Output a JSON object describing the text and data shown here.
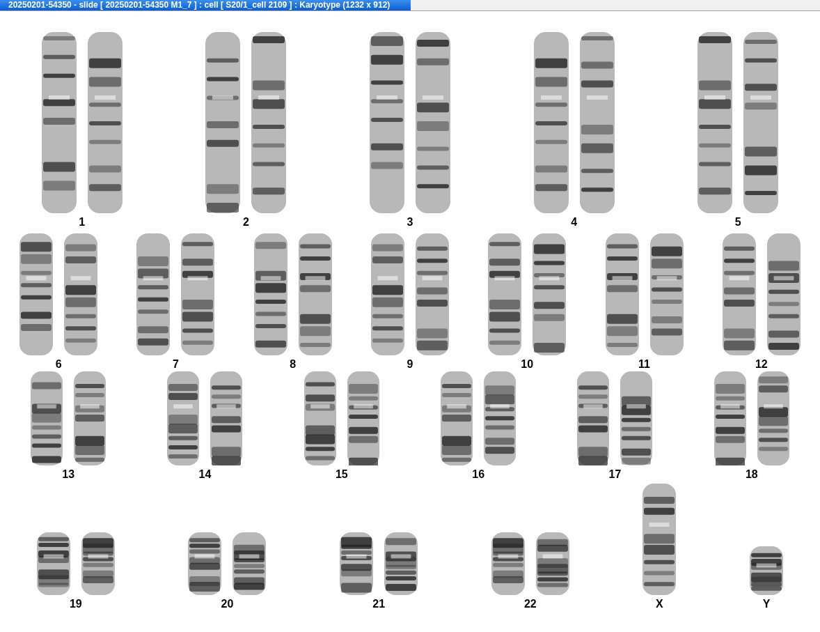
{
  "window": {
    "title": "20250201-54350 - slide [ 20250201-54350 M1_7 ] : cell [ S20/1_cell 2109 ] : Karyotype  (1232 x 912)"
  },
  "rows": [
    {
      "items": [
        {
          "kind": "pair",
          "label": "1"
        },
        {
          "kind": "pair",
          "label": "2"
        },
        {
          "kind": "pair",
          "label": "3"
        },
        {
          "kind": "pair",
          "label": "4"
        },
        {
          "kind": "pair",
          "label": "5"
        }
      ]
    },
    {
      "items": [
        {
          "kind": "pair",
          "label": "6"
        },
        {
          "kind": "pair",
          "label": "7"
        },
        {
          "kind": "pair",
          "label": "8"
        },
        {
          "kind": "pair",
          "label": "9"
        },
        {
          "kind": "pair",
          "label": "10"
        },
        {
          "kind": "pair",
          "label": "11"
        },
        {
          "kind": "pair",
          "label": "12"
        }
      ]
    },
    {
      "items": [
        {
          "kind": "pair",
          "label": "13"
        },
        {
          "kind": "pair",
          "label": "14"
        },
        {
          "kind": "pair",
          "label": "15"
        },
        {
          "kind": "pair",
          "label": "16"
        },
        {
          "kind": "pair",
          "label": "17"
        },
        {
          "kind": "pair",
          "label": "18"
        }
      ]
    },
    {
      "items": [
        {
          "kind": "pair",
          "label": "19"
        },
        {
          "kind": "pair",
          "label": "20"
        },
        {
          "kind": "pair",
          "label": "21"
        },
        {
          "kind": "pair",
          "label": "22"
        },
        {
          "kind": "long",
          "label": "X"
        },
        {
          "kind": "short",
          "label": "Y"
        }
      ]
    }
  ]
}
